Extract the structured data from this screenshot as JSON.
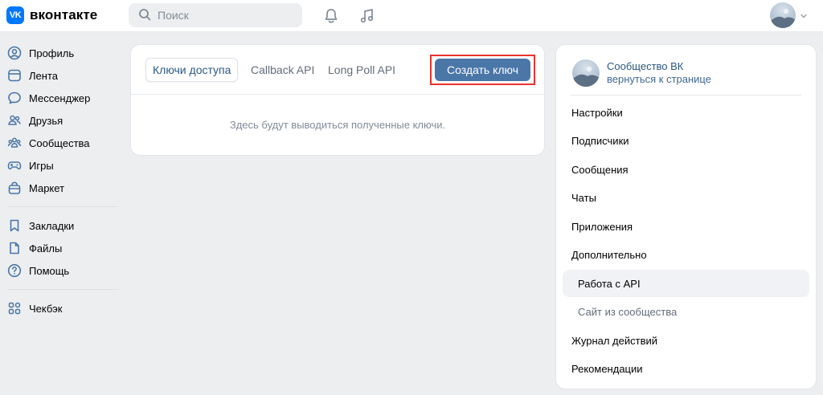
{
  "header": {
    "logo_mark": "VK",
    "logo_text": "вконтакте",
    "search_placeholder": "Поиск"
  },
  "leftnav": {
    "items": [
      {
        "label": "Профиль",
        "icon": "user-icon"
      },
      {
        "label": "Лента",
        "icon": "news-icon"
      },
      {
        "label": "Мессенджер",
        "icon": "message-icon"
      },
      {
        "label": "Друзья",
        "icon": "friends-icon"
      },
      {
        "label": "Сообщества",
        "icon": "communities-icon"
      },
      {
        "label": "Игры",
        "icon": "gamepad-icon"
      },
      {
        "label": "Маркет",
        "icon": "bag-icon"
      },
      {
        "label": "Закладки",
        "icon": "bookmark-icon"
      },
      {
        "label": "Файлы",
        "icon": "file-icon"
      },
      {
        "label": "Помощь",
        "icon": "help-icon"
      },
      {
        "label": "Чекбэк",
        "icon": "grid-icon"
      }
    ]
  },
  "main": {
    "tabs": [
      {
        "label": "Ключи доступа",
        "active": true
      },
      {
        "label": "Callback API",
        "active": false
      },
      {
        "label": "Long Poll API",
        "active": false
      }
    ],
    "create_button": "Создать ключ",
    "empty_text": "Здесь будут выводиться полученные ключи."
  },
  "rightpanel": {
    "community_name": "Сообщество ВК",
    "community_back": "вернуться к странице",
    "menu": [
      {
        "label": "Настройки"
      },
      {
        "label": "Подписчики"
      },
      {
        "label": "Сообщения"
      },
      {
        "label": "Чаты"
      },
      {
        "label": "Приложения"
      },
      {
        "label": "Дополнительно"
      },
      {
        "label": "Работа с API",
        "sub": true,
        "selected": true
      },
      {
        "label": "Сайт из сообщества",
        "sub": true
      },
      {
        "label": "Журнал действий"
      },
      {
        "label": "Рекомендации"
      }
    ]
  },
  "colors": {
    "accent": "#4a76a8",
    "link": "#2a5885",
    "highlight": "#e8332e",
    "background": "#edeef0"
  }
}
